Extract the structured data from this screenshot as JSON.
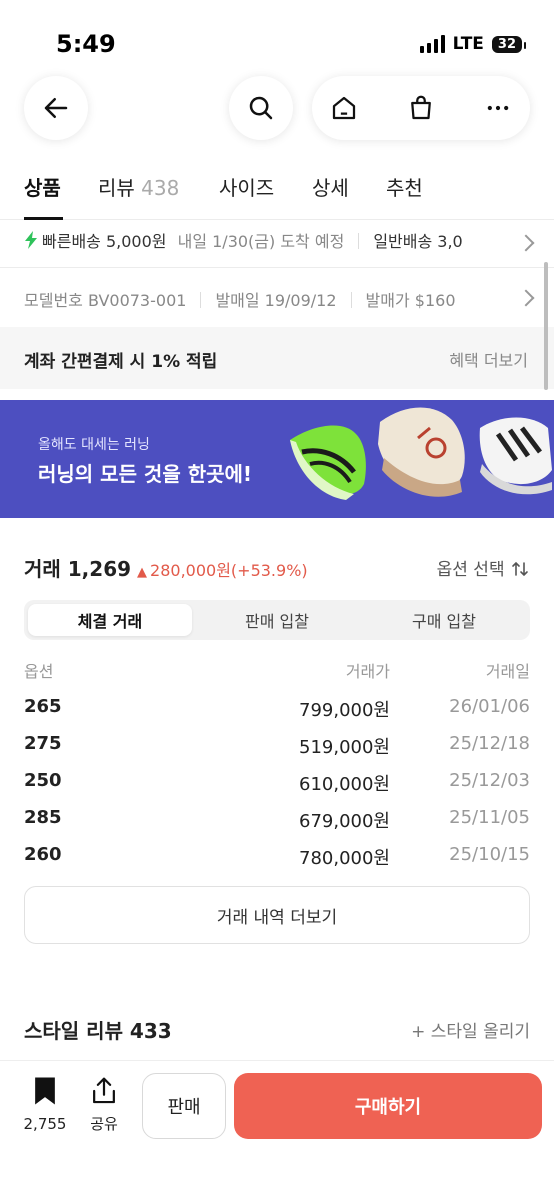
{
  "status_bar": {
    "time": "5:49",
    "network": "LTE",
    "battery": "32"
  },
  "nav": {
    "back_icon": "arrow-left-icon",
    "search_icon": "search-icon",
    "home_icon": "home-icon",
    "bag_icon": "shopping-bag-icon",
    "more_icon": "more-horizontal-icon"
  },
  "tabs": [
    {
      "label": "상품",
      "count": ""
    },
    {
      "label": "리뷰",
      "count": "438"
    },
    {
      "label": "사이즈",
      "count": ""
    },
    {
      "label": "상세",
      "count": ""
    },
    {
      "label": "추천",
      "count": ""
    }
  ],
  "shipping": {
    "fast_label": "빠른배송 5,000원",
    "fast_eta": "내일 1/30(금) 도착 예정",
    "normal_label": "일반배송 3,0"
  },
  "model_info": {
    "model_no": "모델번호 BV0073-001",
    "release_date": "발매일 19/09/12",
    "release_price": "발매가 $160"
  },
  "benefit": {
    "label": "계좌 간편결제 시 1% 적립",
    "link": "혜택 더보기"
  },
  "banner": {
    "subtitle": "올해도 대세는 러닝",
    "title": "러닝의 모든 것을 한곳에!",
    "bg_color": "#4d4fc0"
  },
  "trade": {
    "title": "거래 1,269",
    "change_arrow": "▲",
    "change": "280,000원(+53.9%)",
    "option_select": "옵션 선택",
    "segments": [
      "체결 거래",
      "판매 입찰",
      "구매 입찰"
    ],
    "headers": [
      "옵션",
      "거래가",
      "거래일"
    ],
    "rows": [
      [
        "265",
        "799,000원",
        "26/01/06"
      ],
      [
        "275",
        "519,000원",
        "25/12/18"
      ],
      [
        "250",
        "610,000원",
        "25/12/03"
      ],
      [
        "285",
        "679,000원",
        "25/11/05"
      ],
      [
        "260",
        "780,000원",
        "25/10/15"
      ]
    ],
    "more_button": "거래 내역 더보기",
    "up_color": "#e25a4a"
  },
  "style_review": {
    "title": "스타일 리뷰 433",
    "upload": "+ 스타일 올리기"
  },
  "bottom_bar": {
    "bookmark_count": "2,755",
    "share_label": "공유",
    "sell_label": "판매",
    "buy_label": "구매하기",
    "buy_color": "#ef6253"
  }
}
